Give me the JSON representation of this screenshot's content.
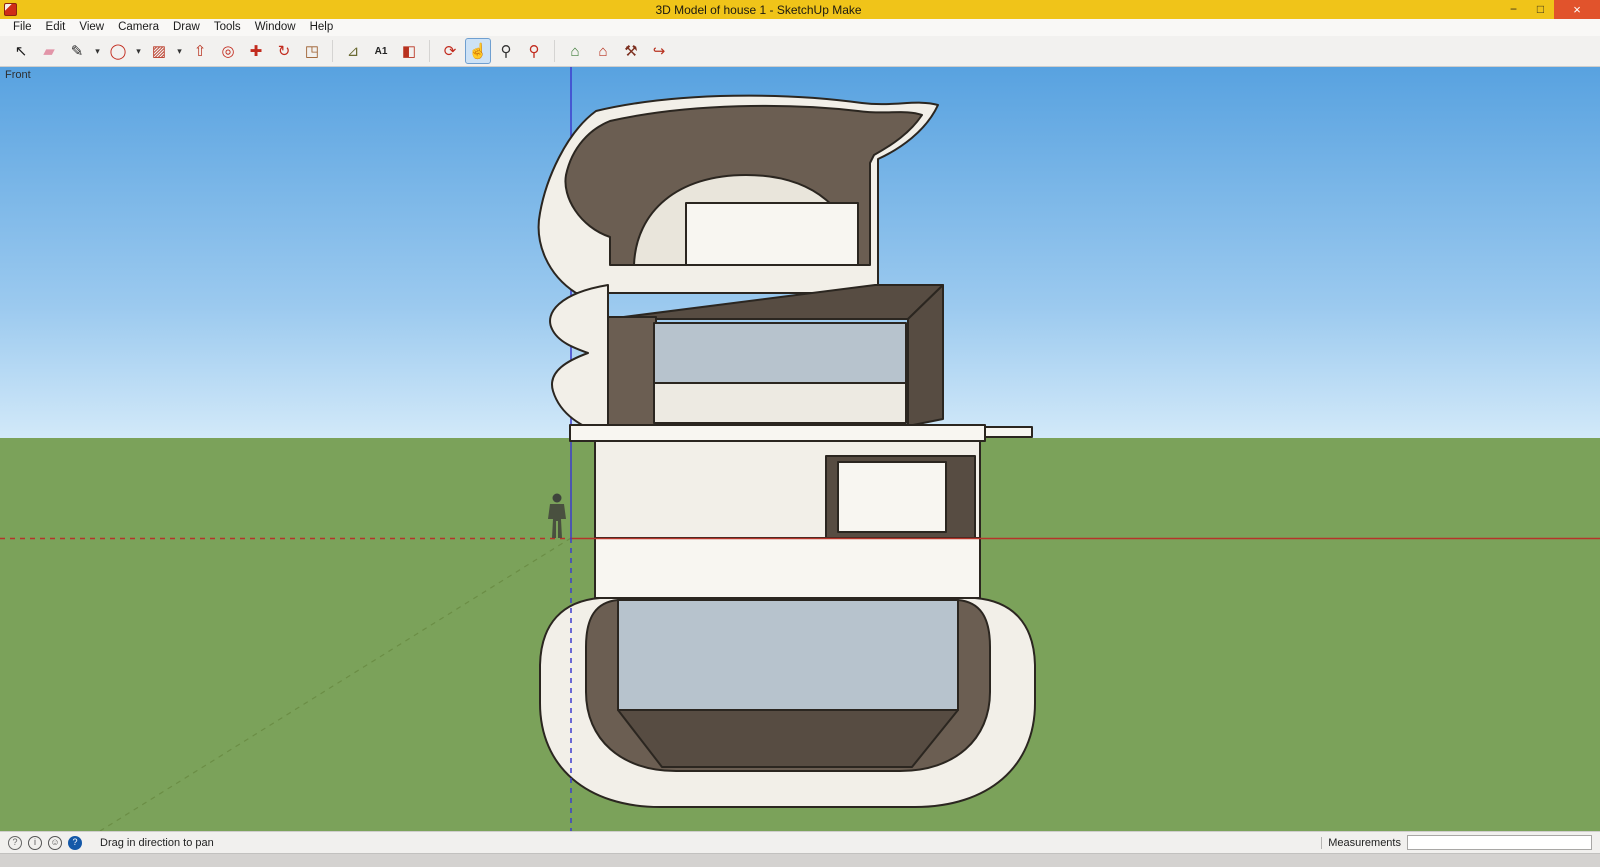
{
  "window": {
    "title": "3D Model of house 1 - SketchUp Make",
    "minimize": "−",
    "maximize": "□",
    "close": "×"
  },
  "menubar": {
    "items": [
      "File",
      "Edit",
      "View",
      "Camera",
      "Draw",
      "Tools",
      "Window",
      "Help"
    ]
  },
  "toolbar": {
    "tools": [
      {
        "name": "select-tool",
        "glyph": "↖",
        "color": "#1a1a1a"
      },
      {
        "name": "eraser-tool",
        "glyph": "▰",
        "color": "#e295a8"
      },
      {
        "name": "line-tool",
        "glyph": "✎",
        "color": "#2a2a2a"
      },
      {
        "name": "line-dropdown",
        "glyph": "▾",
        "color": "#333333",
        "dropdown": true
      },
      {
        "name": "circle-tool",
        "glyph": "◯",
        "color": "#c22b1e"
      },
      {
        "name": "arc-dropdown",
        "glyph": "▾",
        "color": "#333333",
        "dropdown": true
      },
      {
        "name": "rectangle-tool",
        "glyph": "▨",
        "color": "#b8321f"
      },
      {
        "name": "shapes-dropdown",
        "glyph": "▾",
        "color": "#333333",
        "dropdown": true
      },
      {
        "name": "push-pull-tool",
        "glyph": "⇧",
        "color": "#b8321f"
      },
      {
        "name": "offset-tool",
        "glyph": "◎",
        "color": "#c22b1e"
      },
      {
        "name": "move-tool",
        "glyph": "✚",
        "color": "#c22b1e"
      },
      {
        "name": "rotate-tool",
        "glyph": "↻",
        "color": "#c22b1e"
      },
      {
        "name": "scale-tool",
        "glyph": "◳",
        "color": "#9a5a28"
      },
      {
        "sep": true
      },
      {
        "name": "tape-measure-tool",
        "glyph": "⊿",
        "color": "#6b6b33"
      },
      {
        "name": "text-tool",
        "glyph": "A1",
        "color": "#222222",
        "text": true
      },
      {
        "name": "paint-bucket-tool",
        "glyph": "◧",
        "color": "#b8321f"
      },
      {
        "sep": true
      },
      {
        "name": "orbit-tool",
        "glyph": "⟳",
        "color": "#c22b1e"
      },
      {
        "name": "pan-tool",
        "glyph": "☝",
        "color": "#c08338",
        "active": true
      },
      {
        "name": "zoom-tool",
        "glyph": "⚲",
        "color": "#333333"
      },
      {
        "name": "zoom-extents-tool",
        "glyph": "⚲",
        "color": "#c22b1e"
      },
      {
        "sep": true
      },
      {
        "name": "get-models-tool",
        "glyph": "⌂",
        "color": "#3f7d3a"
      },
      {
        "name": "share-model-tool",
        "glyph": "⌂",
        "color": "#b8321f"
      },
      {
        "name": "extension-warehouse-tool",
        "glyph": "⚒",
        "color": "#7c2f1e"
      },
      {
        "name": "send-to-layout-tool",
        "glyph": "↪",
        "color": "#b8321f"
      }
    ]
  },
  "viewport": {
    "view_label": "Front"
  },
  "statusbar": {
    "icons": [
      {
        "name": "geolocate-icon",
        "glyph": "?",
        "color": "#666666"
      },
      {
        "name": "credits-icon",
        "glyph": "i",
        "color": "#555555"
      },
      {
        "name": "sign-in-icon",
        "glyph": "☺",
        "color": "#555555"
      },
      {
        "name": "help-icon",
        "glyph": "?",
        "color": "#ffffff",
        "filled": true
      }
    ],
    "status_text": "Drag in direction to pan",
    "measurements_label": "Measurements",
    "measurements_value": ""
  },
  "colors": {
    "titlebar": "#f0c419",
    "close": "#e1532c",
    "sky_top": "#58a2e0",
    "sky_mid": "#9ccaef",
    "sky_horizon": "#d2e9f9",
    "ground": "#7ba25a",
    "model_cream": "#f2efe8",
    "model_cream_bright": "#f8f6f1",
    "model_dark": "#6b5e52",
    "model_dark2": "#574c42",
    "glass": "#b7c3cd",
    "edge": "#2b2620",
    "axis_red": "#b5342a",
    "axis_blue": "#3c3ccd",
    "axis_green": "#5e7d35"
  }
}
